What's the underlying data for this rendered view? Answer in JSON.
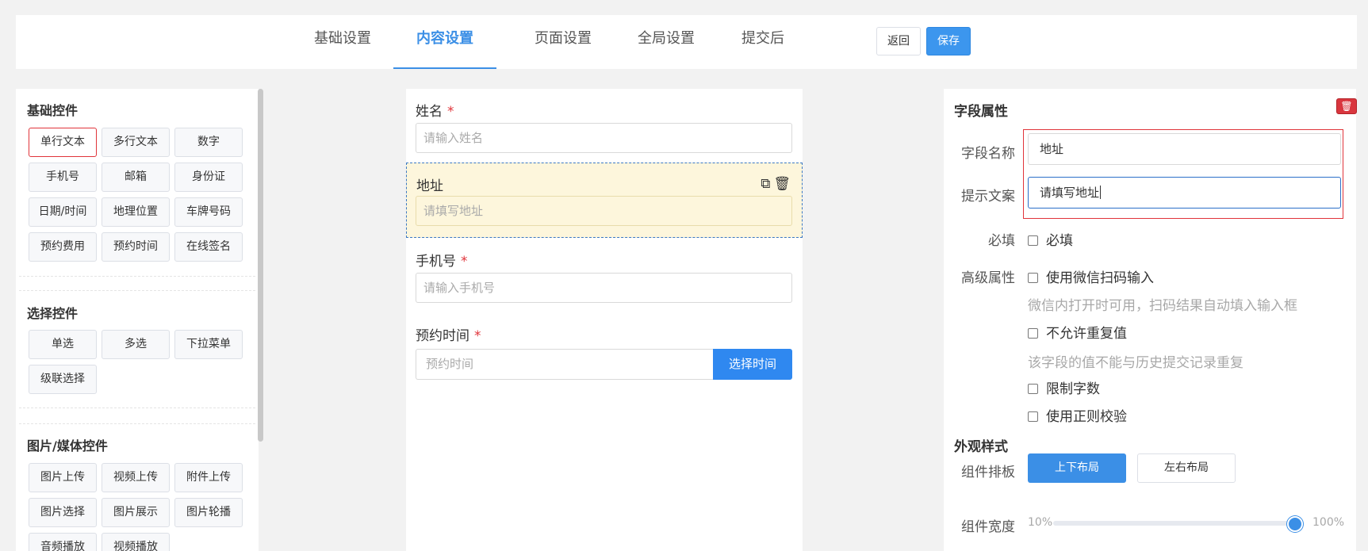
{
  "tabs": [
    {
      "label": "基础设置",
      "active": false
    },
    {
      "label": "内容设置",
      "active": true
    },
    {
      "label": "页面设置",
      "active": false
    },
    {
      "label": "全局设置",
      "active": false
    },
    {
      "label": "提交后",
      "active": false
    }
  ],
  "header_actions": {
    "back_label": "返回",
    "save_label": "保存"
  },
  "palette": {
    "basic": {
      "title": "基础控件",
      "items": [
        "单行文本",
        "多行文本",
        "数字",
        "手机号",
        "邮箱",
        "身份证",
        "日期/时间",
        "地理位置",
        "车牌号码",
        "预约费用",
        "预约时间",
        "在线签名"
      ],
      "selected": "单行文本"
    },
    "choice": {
      "title": "选择控件",
      "items": [
        "单选",
        "多选",
        "下拉菜单",
        "级联选择"
      ]
    },
    "media": {
      "title": "图片/媒体控件",
      "items": [
        "图片上传",
        "视频上传",
        "附件上传",
        "图片选择",
        "图片展示",
        "图片轮播",
        "音频播放",
        "视频播放"
      ]
    }
  },
  "form": {
    "fields": [
      {
        "label": "姓名",
        "required_mark": "*",
        "placeholder": "请输入姓名"
      },
      {
        "label": "地址",
        "required_mark": "",
        "placeholder": "请填写地址",
        "selected": true
      },
      {
        "label": "手机号",
        "required_mark": "*",
        "placeholder": "请输入手机号"
      },
      {
        "label": "预约时间",
        "required_mark": "*",
        "placeholder": "预约时间",
        "button": "选择时间"
      }
    ],
    "selected_icons": {
      "copy": "copy-icon",
      "delete": "trash-icon"
    }
  },
  "props": {
    "title": "字段属性",
    "delete_icon": "trash-icon",
    "name_label": "字段名称",
    "name_value": "地址",
    "hint_label": "提示文案",
    "hint_value": "请填写地址",
    "required_label": "必填",
    "required_option": "必填",
    "advanced_label": "高级属性",
    "wechat_scan": "使用微信扫码输入",
    "wechat_hint": "微信内打开时可用，扫码结果自动填入输入框",
    "no_duplicate": "不允许重复值",
    "no_duplicate_hint": "该字段的值不能与历史提交记录重复",
    "limit_chars": "限制字数",
    "regex_check": "使用正则校验",
    "appearance_title": "外观样式",
    "layout_label": "组件排板",
    "layout_options": [
      "上下布局",
      "左右布局"
    ],
    "layout_selected": "上下布局",
    "width_label": "组件宽度",
    "width_min": "10%",
    "width_max": "100%",
    "width_value_percent": 100
  },
  "colors": {
    "accent": "#3b8fe6",
    "danger": "#e0343a",
    "selected_field_bg": "#fdf6dc"
  }
}
